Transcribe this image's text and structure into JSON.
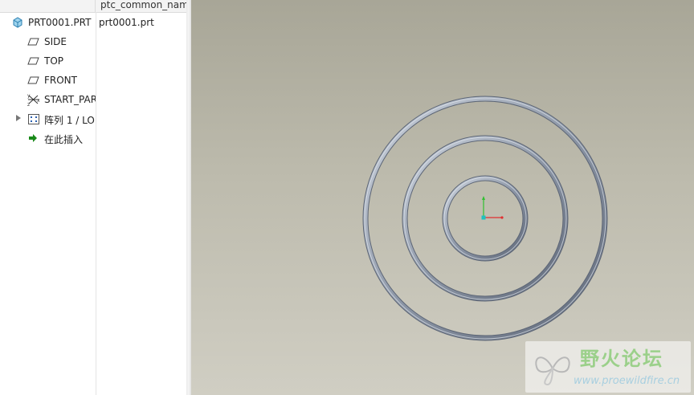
{
  "model_tree": {
    "column_header": "ptc_common_nam",
    "rows": [
      {
        "label": "PRT0001.PRT",
        "param": "prt0001.prt",
        "icon": "part-icon"
      },
      {
        "label": "SIDE",
        "icon": "datum-plane-icon"
      },
      {
        "label": "TOP",
        "icon": "datum-plane-icon"
      },
      {
        "label": "FRONT",
        "icon": "datum-plane-icon"
      },
      {
        "label": "START_PAR",
        "icon": "coordinate-system-icon"
      },
      {
        "label": "阵列 1 / LO",
        "icon": "pattern-icon",
        "expandable": true
      },
      {
        "label": "在此插入",
        "icon": "insert-here-arrow-icon"
      }
    ]
  },
  "coordinate_system_axes": {
    "x_color": "#e03030",
    "y_color": "#30c030",
    "origin_color": "#20c0c0"
  },
  "graphics": {
    "background_top": "#a8a697",
    "background_bottom": "#d0cec3",
    "ring_color": "#8a94a3"
  },
  "watermark": {
    "title": "野火论坛",
    "url": "www.proewildfire.cn"
  }
}
